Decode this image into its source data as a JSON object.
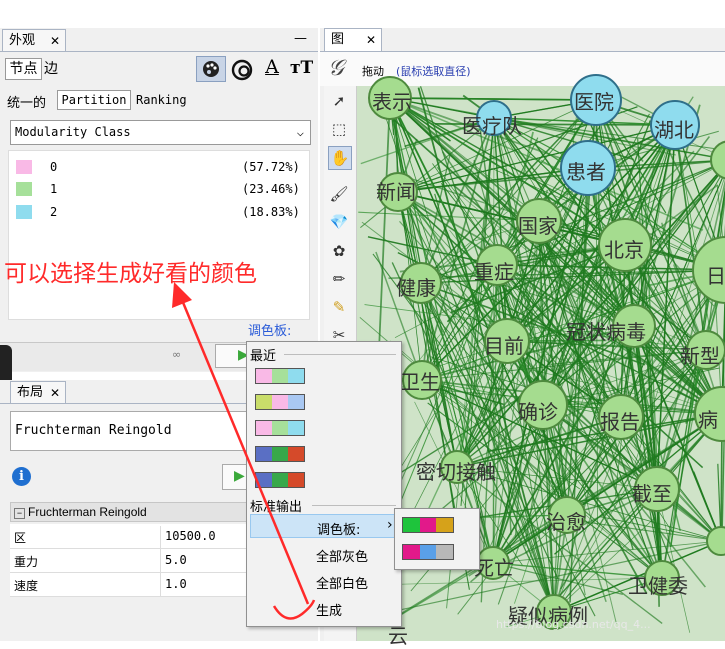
{
  "appearance": {
    "tab_title": "外观",
    "tab_close": "✕",
    "minimize": "—",
    "subtabs": [
      "节点",
      "边"
    ],
    "mode_tabs": [
      "统一的",
      "Partition",
      "Ranking"
    ],
    "dropdown_value": "Modularity Class",
    "partitions": [
      {
        "label": "0",
        "pct": "(57.72%)",
        "color": "#f9b9e6"
      },
      {
        "label": "1",
        "pct": "(23.46%)",
        "color": "#a6e09a"
      },
      {
        "label": "2",
        "pct": "(18.83%)",
        "color": "#8fdcee"
      }
    ],
    "palette_link": "调色板:",
    "annotation": "可以选择生成好看的颜色"
  },
  "layout": {
    "tab_title": "布局",
    "tab_close": "✕",
    "algorithm": "Fruchterman Reingold",
    "section_title": "Fruchterman Reingold",
    "props": [
      {
        "name": "区",
        "value": "10500.0"
      },
      {
        "name": "重力",
        "value": "5.0"
      },
      {
        "name": "速度",
        "value": "1.0"
      }
    ]
  },
  "graph": {
    "tab_title": "图",
    "tab_close": "✕",
    "drag_label": "拖动",
    "drag_hint": "(鼠标选取直径)",
    "watermark": "https://blog.csdn.net/qq_4...",
    "nodes": [
      {
        "label": "表示",
        "color": "#a5dc8f"
      },
      {
        "label": "医疗队",
        "color": "#8fdcee"
      },
      {
        "label": "医院",
        "color": "#8fdcee"
      },
      {
        "label": "湖北",
        "color": "#8fdcee"
      },
      {
        "label": "患者",
        "color": "#8fdcee"
      },
      {
        "label": "新闻",
        "color": "#a5dc8f"
      },
      {
        "label": "国家",
        "color": "#a5dc8f"
      },
      {
        "label": "北京",
        "color": "#a5dc8f"
      },
      {
        "label": "日",
        "color": "#a5dc8f"
      },
      {
        "label": "健康",
        "color": "#a5dc8f"
      },
      {
        "label": "重症",
        "color": "#a5dc8f"
      },
      {
        "label": "目前",
        "color": "#a5dc8f"
      },
      {
        "label": "冠状病毒",
        "color": "#a5dc8f"
      },
      {
        "label": "新型",
        "color": "#a5dc8f"
      },
      {
        "label": "卫生",
        "color": "#a5dc8f"
      },
      {
        "label": "确诊",
        "color": "#a5dc8f"
      },
      {
        "label": "报告",
        "color": "#a5dc8f"
      },
      {
        "label": "病",
        "color": "#a5dc8f"
      },
      {
        "label": "密切接触",
        "color": "#a5dc8f"
      },
      {
        "label": "截至",
        "color": "#a5dc8f"
      },
      {
        "label": "治愈",
        "color": "#a5dc8f"
      },
      {
        "label": "死亡",
        "color": "#a5dc8f"
      },
      {
        "label": "卫健委",
        "color": "#a5dc8f"
      },
      {
        "label": "疑似病例",
        "color": "#a5dc8f"
      },
      {
        "label": "云",
        "color": "#a5dc8f"
      }
    ]
  },
  "palette_menu": {
    "recent_title": "最近",
    "recent_palettes": [
      [
        "#f9b9e6",
        "#a6e09a",
        "#8fdcee"
      ],
      [
        "#c9dd6a",
        "#f9b9e6",
        "#a9c8f2"
      ],
      [
        "#f9b9e6",
        "#a6e09a",
        "#8fdcee"
      ],
      [
        "#5a6fc4",
        "#38a84a",
        "#d54a2a"
      ],
      [
        "#5a6fc4",
        "#38a84a",
        "#d54a2a"
      ]
    ],
    "standard_title": "标准输出",
    "items": [
      {
        "label": "调色板:",
        "arrow": "›"
      },
      {
        "label": "全部灰色"
      },
      {
        "label": "全部白色"
      },
      {
        "label": "生成"
      }
    ]
  },
  "palette_submenu": [
    [
      "#1ec43c",
      "#e2198a",
      "#d6a21a"
    ],
    [
      "#e2198a",
      "#5aa0e8",
      "#b8b8b8"
    ]
  ]
}
